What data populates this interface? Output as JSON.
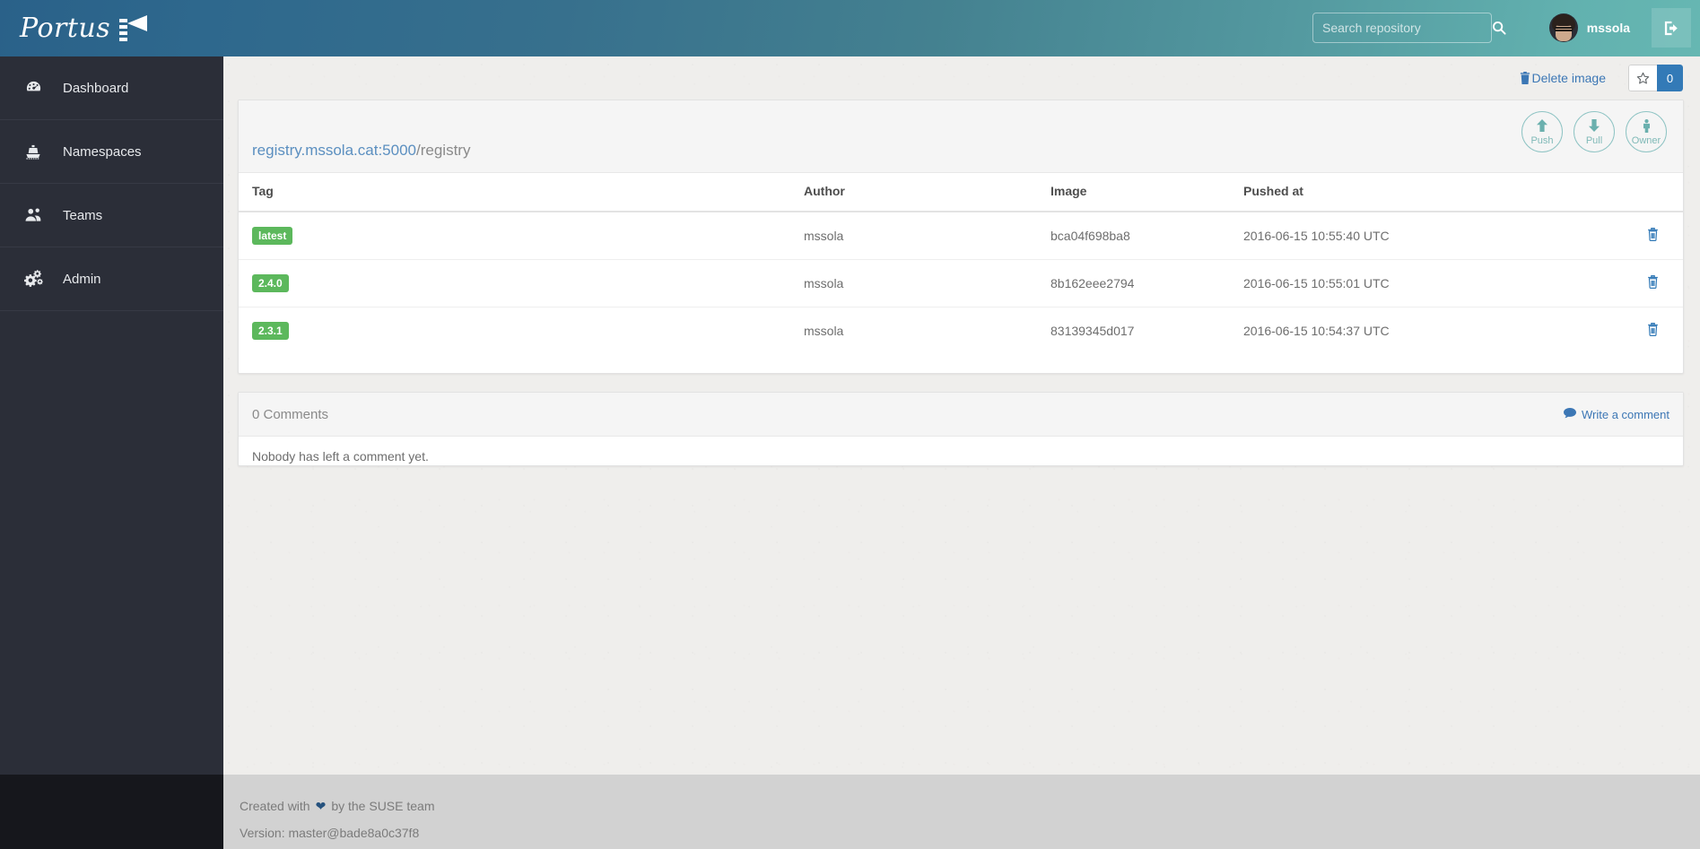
{
  "app": {
    "brand_name": "Portus",
    "brand_icon": "lighthouse-icon"
  },
  "header": {
    "search": {
      "placeholder": "Search repository",
      "value": "",
      "icon": "search-icon"
    },
    "user": {
      "name": "mssola",
      "avatar_icon": "user-avatar"
    },
    "logout_icon": "sign-out-icon",
    "gradient_start": "#2a6189",
    "gradient_end": "#66b7b2"
  },
  "sidebar": {
    "background": "#2b2e38",
    "items": [
      {
        "label": "Dashboard",
        "icon": "dashboard-icon"
      },
      {
        "label": "Namespaces",
        "icon": "ship-icon"
      },
      {
        "label": "Teams",
        "icon": "users-icon"
      },
      {
        "label": "Admin",
        "icon": "cogs-icon"
      }
    ]
  },
  "toolbar": {
    "delete_image_label": "Delete image",
    "delete_image_icon": "trash-icon",
    "star_icon": "star-outline-icon",
    "star_count": "0"
  },
  "repository": {
    "namespace": "registry.mssola.cat:5000",
    "separator": "/",
    "name": "registry",
    "actions": [
      {
        "label": "Push",
        "icon": "arrow-up-icon"
      },
      {
        "label": "Pull",
        "icon": "arrow-down-icon"
      },
      {
        "label": "Owner",
        "icon": "person-icon"
      }
    ]
  },
  "tags_table": {
    "columns": [
      "Tag",
      "Author",
      "Image",
      "Pushed at"
    ],
    "delete_row_icon": "trash-icon",
    "rows": [
      {
        "tag": "latest",
        "author": "mssola",
        "image": "bca04f698ba8",
        "pushed_at": "2016-06-15 10:55:40 UTC"
      },
      {
        "tag": "2.4.0",
        "author": "mssola",
        "image": "8b162eee2794",
        "pushed_at": "2016-06-15 10:55:01 UTC"
      },
      {
        "tag": "2.3.1",
        "author": "mssola",
        "image": "83139345d017",
        "pushed_at": "2016-06-15 10:54:37 UTC"
      }
    ],
    "badge_color": "#5cb85c"
  },
  "comments": {
    "count_label": "0 Comments",
    "write_label": "Write a comment",
    "write_icon": "comment-icon",
    "empty_text": "Nobody has left a comment yet."
  },
  "footer": {
    "created_prefix": "Created with",
    "heart_icon": "heart-icon",
    "created_suffix": "by the SUSE team",
    "version": "Version: master@bade8a0c37f8"
  }
}
